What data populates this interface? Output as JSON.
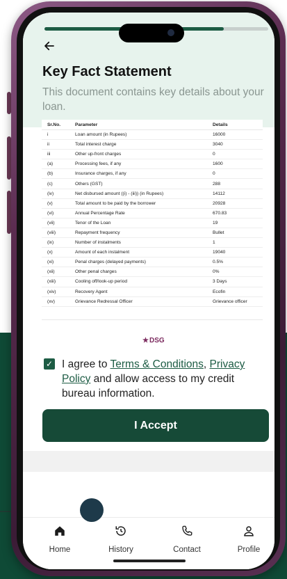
{
  "app": {
    "progress_percent": 80,
    "back_icon": "arrow-left-icon"
  },
  "header": {
    "title": "Key Fact Statement",
    "subtitle": "This document contains key details about your loan."
  },
  "table": {
    "columns": [
      "Sr.No.",
      "Parameter",
      "Details"
    ],
    "rows": [
      [
        "i",
        "Loan amount (in Rupees)",
        "16000"
      ],
      [
        "ii",
        "Total interest charge",
        "3040"
      ],
      [
        "iii",
        "Other up-front charges",
        "0"
      ],
      [
        "(a)",
        "Processing fees, if any",
        "1600"
      ],
      [
        "(b)",
        "Insurance charges, if any",
        "0"
      ],
      [
        "(c)",
        "Others (GST)",
        "288"
      ],
      [
        "(iv)",
        "Net disbursed amount ((i) - (iii)) (in Rupees)",
        "14112"
      ],
      [
        "(v)",
        "Total amount to be paid by the borrower",
        "20928"
      ],
      [
        "(vi)",
        "Annual Percentage Rate",
        "670.83"
      ],
      [
        "(vii)",
        "Tenor of the Loan",
        "19"
      ],
      [
        "(viii)",
        "Repayment frequency",
        "Bullet"
      ],
      [
        "(ix)",
        "Number of instalments",
        "1"
      ],
      [
        "(x)",
        "Amount of each instalment",
        "19040"
      ],
      [
        "(xi)",
        "Penal charges (delayed payments)",
        "0.5%"
      ],
      [
        "(xii)",
        "Other penal charges",
        "0%"
      ],
      [
        "(xiii)",
        "Cooling off/look-up period",
        "3 Days"
      ],
      [
        "(xiv)",
        "Recovery Agent",
        "Ecofin"
      ],
      [
        "(xv)",
        "Grievance Redressal Officer",
        "Grievance officer"
      ]
    ]
  },
  "logo": {
    "text": "DSG"
  },
  "consent": {
    "checked": true,
    "prefix": "I agree to ",
    "terms_link": "Terms & Conditions",
    "separator": ", ",
    "privacy_link": "Privacy Policy",
    "suffix": " and allow access to my credit bureau information."
  },
  "accept_button": {
    "label": "I Accept"
  },
  "nav": {
    "items": [
      {
        "label": "Home",
        "icon": "home-icon"
      },
      {
        "label": "History",
        "icon": "history-icon"
      },
      {
        "label": "Contact",
        "icon": "phone-icon"
      },
      {
        "label": "Profile",
        "icon": "user-icon"
      }
    ]
  },
  "colors": {
    "brand_green": "#164a37",
    "background_green": "#0f4a36",
    "header_tint": "#e7f3ed",
    "phone_frame": "#5b2c50"
  }
}
